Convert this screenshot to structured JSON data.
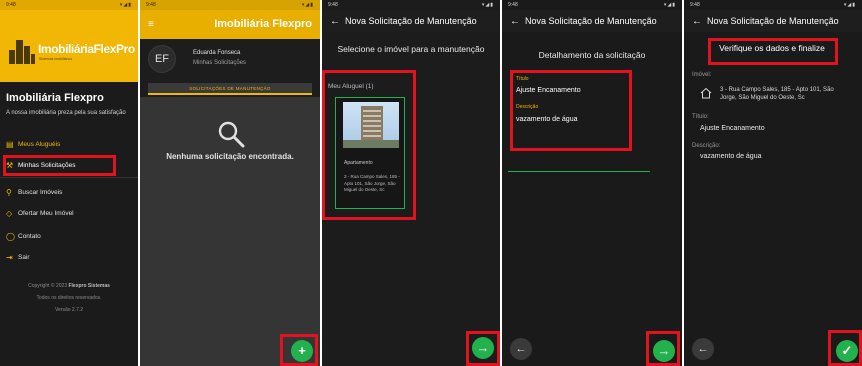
{
  "status_bar": {
    "time": "9:48",
    "icons": "▾◢▮"
  },
  "drawer": {
    "logo_name": "ImobiliáriaFlexPro",
    "logo_tagline": "Sistemas Imobiliários",
    "title": "Imobiliária Flexpro",
    "subtitle": "A nossa imobiliária preza pela sua satisfação",
    "items": [
      {
        "label": "Meus Aluguéis",
        "icon": "calendar-icon",
        "glyph": "▤"
      },
      {
        "label": "Minhas Solicitações",
        "icon": "wrench-icon",
        "glyph": "⚒"
      },
      {
        "label": "Buscar Imóveis",
        "icon": "search-icon",
        "glyph": "⚲"
      },
      {
        "label": "Ofertar Meu Imóvel",
        "icon": "tag-icon",
        "glyph": "◇"
      },
      {
        "label": "Contato",
        "icon": "chat-icon",
        "glyph": "◯"
      },
      {
        "label": "Sair",
        "icon": "logout-icon",
        "glyph": "⇥"
      }
    ],
    "copyright_prefix": "Copyright © 2023 ",
    "copyright_brand": "Flexpro Sistemas",
    "rights": "Todos os direitos reservados.",
    "version": "Versão 2.7.2"
  },
  "solicitations": {
    "app_title": "Imobiliária Flexpro",
    "avatar_initials": "EF",
    "user_name": "Eduarda Fonseca",
    "user_sub": "Minhas Solicitações",
    "tab_label": "SOLICITAÇÕES DE MANUTENÇÃO",
    "empty_text": "Nenhuma solicitação encontrada.",
    "fab_label": "+"
  },
  "select_property": {
    "title": "Nova Solicitação de Manutenção",
    "heading": "Selecione o imóvel para a manutenção",
    "group_label": "Meu Aluguel (1)",
    "card_type": "Apartamento",
    "card_address": "3 - Rua Campo Sales, 185 - Apto 101, São Jorge, São Miguel do Oeste, Sc",
    "next_label": "→"
  },
  "details": {
    "title": "Nova Solicitação de Manutenção",
    "heading": "Detalhamento da solicitação",
    "title_label": "Título",
    "title_value": "Ajuste Encanamento",
    "desc_label": "Descrição",
    "desc_value": "vazamento de água",
    "back_label": "←",
    "next_label": "→"
  },
  "confirm": {
    "title": "Nova Solicitação de Manutenção",
    "heading": "Verifique os dados e finalize",
    "property_label": "Imóvel:",
    "property_value": "3 - Rua Campo Sales, 185 - Apto 101, São Jorge, São Miguel do Oeste, Sc",
    "title_label": "Título:",
    "title_value": "Ajuste Encanamento",
    "desc_label": "Descrição:",
    "desc_value": "vazamento de água",
    "back_label": "←",
    "finish_label": "✓"
  },
  "colors": {
    "accent": "#f2b705",
    "green": "#22b14c",
    "highlight": "#e0131f"
  }
}
